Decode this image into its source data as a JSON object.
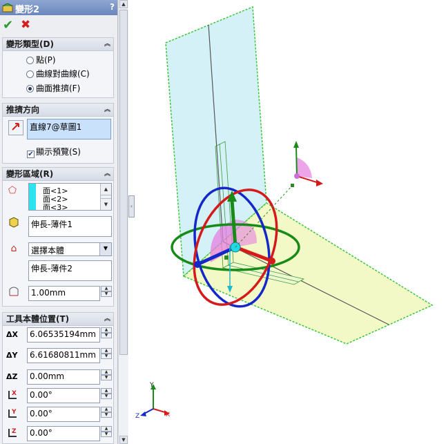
{
  "feature": {
    "title": "變形2",
    "help": "?",
    "ok_icon": "checkmark-icon",
    "cancel_icon": "x-icon"
  },
  "deform_type": {
    "header": "變形類型(D)",
    "options": [
      "點(P)",
      "曲線對曲線(C)",
      "曲面推擠(F)"
    ],
    "selected_index": 2
  },
  "push_direction": {
    "header": "推擠方向",
    "value": "直線7@草圖1",
    "show_preview_label": "顯示預覽(S)",
    "show_preview_checked": true
  },
  "deform_region": {
    "header": "變形區域(R)",
    "faces": [
      "面<1>",
      "面<2>",
      "面<3>"
    ],
    "target_body": "伸長-薄件1",
    "tool_body_select": "選擇本體",
    "tool_body": "伸長-薄件2",
    "deviation": "1.00mm"
  },
  "tool_body_position": {
    "header": "工具本體位置(T)",
    "rows": [
      {
        "label": "ΔX",
        "value": "6.06535194mm"
      },
      {
        "label": "ΔY",
        "value": "6.61680811mm"
      },
      {
        "label": "ΔZ",
        "value": "0.00mm"
      },
      {
        "label": "X",
        "value": "0.00°"
      },
      {
        "label": "Y",
        "value": "0.00°"
      },
      {
        "label": "Z",
        "value": "0.00°"
      }
    ]
  },
  "triad": {
    "x": "X",
    "y": "Y",
    "z": "Z"
  }
}
